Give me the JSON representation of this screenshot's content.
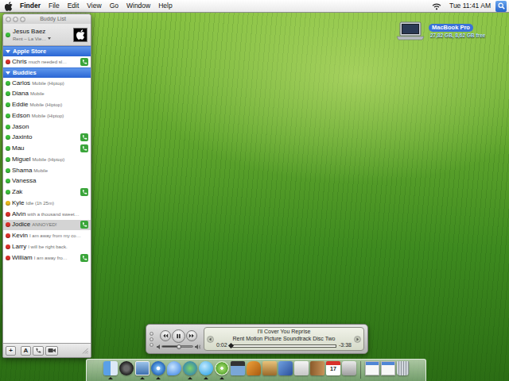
{
  "menubar": {
    "app": "Finder",
    "menus": [
      "File",
      "Edit",
      "View",
      "Go",
      "Window",
      "Help"
    ],
    "clock": "Tue 11:41 AM"
  },
  "buddy_list": {
    "title": "Buddy List",
    "me": {
      "name": "Jesus Baez",
      "status": "Rent – La Vie…",
      "color": "#3cbf3c"
    },
    "groups": [
      {
        "name": "Apple Store",
        "expanded": true,
        "buddies": [
          {
            "name": "Chris",
            "status": "much needed sl…",
            "color": "#d9312b",
            "phone": true,
            "selected": false
          }
        ]
      },
      {
        "name": "Buddies",
        "expanded": true,
        "buddies": [
          {
            "name": "Carlos",
            "status": "Mobile (Hiptop)",
            "color": "#3cbf3c",
            "phone": false,
            "selected": false
          },
          {
            "name": "Diana",
            "status": "Mobile",
            "color": "#3cbf3c",
            "phone": false,
            "selected": false
          },
          {
            "name": "Eddie",
            "status": "Mobile (Hiptop)",
            "color": "#3cbf3c",
            "phone": false,
            "selected": false
          },
          {
            "name": "Edson",
            "status": "Mobile (Hiptop)",
            "color": "#3cbf3c",
            "phone": false,
            "selected": false
          },
          {
            "name": "Jason",
            "color": "#3cbf3c",
            "phone": false,
            "selected": false
          },
          {
            "name": "Jaxinto",
            "color": "#3cbf3c",
            "phone": true,
            "selected": false
          },
          {
            "name": "Mau",
            "color": "#3cbf3c",
            "phone": true,
            "selected": false
          },
          {
            "name": "Miguel",
            "status": "Mobile (Hiptop)",
            "color": "#3cbf3c",
            "phone": false,
            "selected": false
          },
          {
            "name": "Shama",
            "status": "Mobile",
            "color": "#3cbf3c",
            "phone": false,
            "selected": false
          },
          {
            "name": "Vanessa",
            "color": "#3cbf3c",
            "phone": false,
            "selected": false
          },
          {
            "name": "Zak",
            "color": "#3cbf3c",
            "phone": true,
            "selected": false
          },
          {
            "name": "Kyle",
            "status": "Idle (1h 25m)",
            "color": "#e8b81c",
            "phone": false,
            "selected": false
          },
          {
            "name": "Alvin",
            "status": "with a thousand sweet…",
            "color": "#d9312b",
            "phone": false,
            "selected": false
          },
          {
            "name": "Jodice",
            "status": "ANNOYED!",
            "color": "#d9312b",
            "phone": true,
            "selected": true
          },
          {
            "name": "Kevin",
            "status": "I am away from my co…",
            "color": "#d9312b",
            "phone": false,
            "selected": false
          },
          {
            "name": "Larry",
            "status": "I will be right back.",
            "color": "#d9312b",
            "phone": false,
            "selected": false
          },
          {
            "name": "William",
            "status": "I am away fro…",
            "color": "#d9312b",
            "phone": true,
            "selected": false
          }
        ]
      }
    ],
    "toolbar": {
      "add": "+",
      "font": "A"
    }
  },
  "desktop_icon": {
    "label": "MacBook Pro",
    "info": "27,82 GB, 8,62 GB free",
    "selected": true
  },
  "player": {
    "title": "I'll Cover You Reprise",
    "album": "Rent Motion Picture Soundtrack Disc Two",
    "elapsed": "0:02",
    "remaining": "-3:38",
    "progress": {
      "level": 0.01
    },
    "volume": {
      "level": 0.55
    },
    "playing": true
  },
  "dock": {
    "items": [
      {
        "kind": "finder",
        "running": true
      },
      {
        "kind": "dashboard",
        "running": false
      },
      {
        "kind": "preview",
        "running": true
      },
      {
        "kind": "safari",
        "running": true
      },
      {
        "kind": "ichat",
        "running": false
      },
      {
        "kind": "network",
        "running": true
      },
      {
        "kind": "skype",
        "running": true
      },
      {
        "kind": "itunes",
        "running": true
      },
      {
        "kind": "imovie",
        "running": false
      },
      {
        "kind": "garageband",
        "running": false
      },
      {
        "kind": "photos",
        "running": false
      },
      {
        "kind": "pen",
        "running": false
      },
      {
        "kind": "script",
        "running": false
      },
      {
        "kind": "books",
        "running": false
      },
      {
        "kind": "ical",
        "label": "17",
        "running": false
      },
      {
        "kind": "system",
        "running": false
      },
      {
        "kind": "separator"
      },
      {
        "kind": "window",
        "running": false
      },
      {
        "kind": "window",
        "running": false
      },
      {
        "kind": "trash",
        "running": false
      }
    ]
  }
}
